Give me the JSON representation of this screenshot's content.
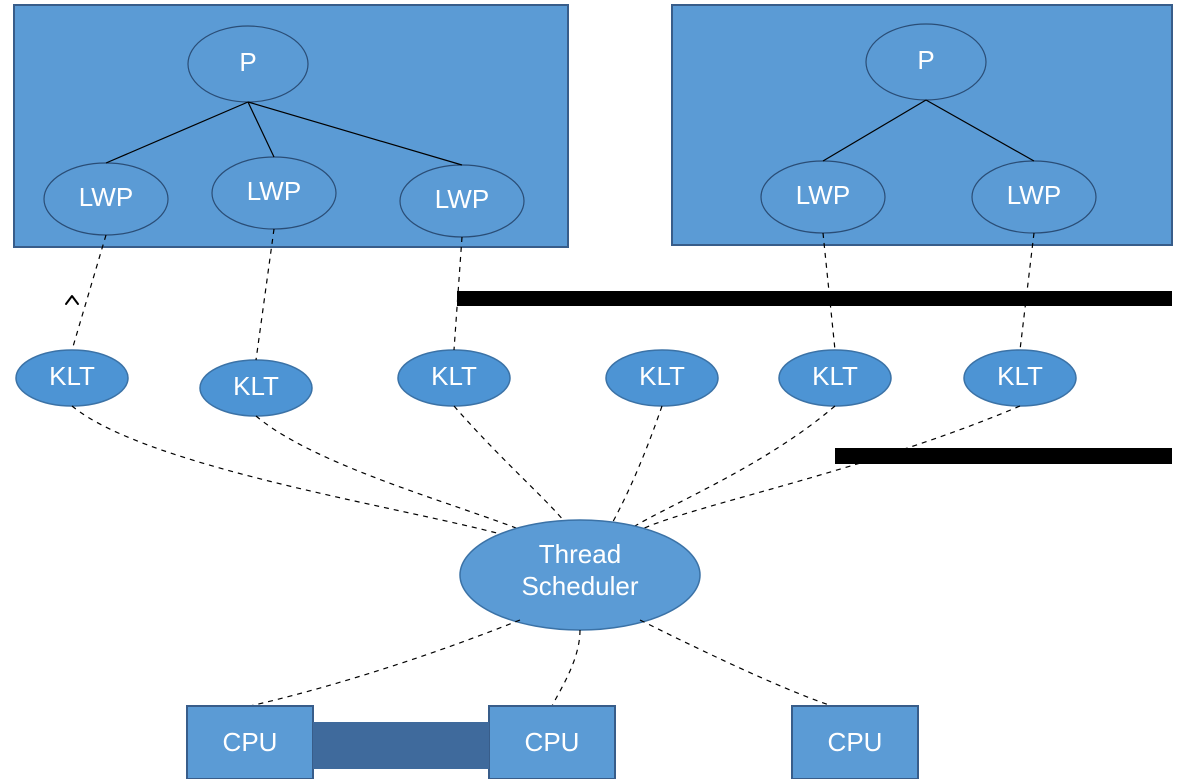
{
  "process1": {
    "p": "P",
    "lwp1": "LWP",
    "lwp2": "LWP",
    "lwp3": "LWP"
  },
  "process2": {
    "p": "P",
    "lwp1": "LWP",
    "lwp2": "LWP"
  },
  "klt": {
    "k1": "KLT",
    "k2": "KLT",
    "k3": "KLT",
    "k4": "KLT",
    "k5": "KLT",
    "k6": "KLT"
  },
  "scheduler": {
    "line1": "Thread",
    "line2": "Scheduler"
  },
  "cpu": {
    "c1": "CPU",
    "c2": "CPU",
    "c3": "CPU"
  },
  "colors": {
    "box": "#5B9BD5"
  }
}
